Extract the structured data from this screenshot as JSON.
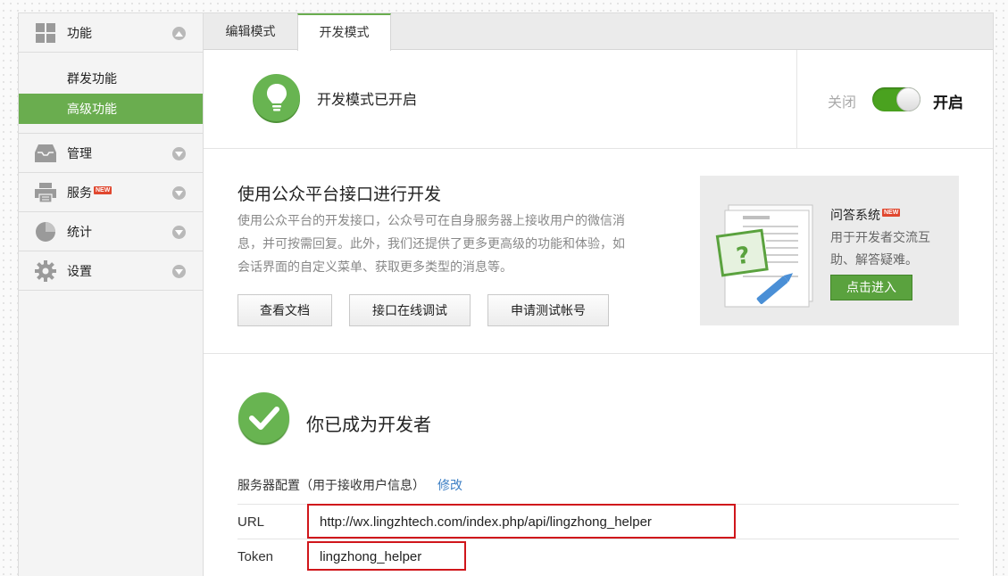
{
  "sidebar": {
    "groups": [
      {
        "label": "功能",
        "icon": "grid-icon"
      },
      {
        "label": "管理",
        "icon": "inbox-icon"
      },
      {
        "label": "服务",
        "icon": "printer-icon",
        "badge": "NEW"
      },
      {
        "label": "统计",
        "icon": "pie-chart-icon"
      },
      {
        "label": "设置",
        "icon": "gear-icon"
      }
    ],
    "sub_items": [
      {
        "label": "群发功能"
      },
      {
        "label": "高级功能"
      }
    ]
  },
  "tabs": [
    {
      "label": "编辑模式"
    },
    {
      "label": "开发模式"
    }
  ],
  "status": {
    "text": "开发模式已开启",
    "toggle_off_label": "关闭",
    "toggle_on_label": "开启",
    "toggle_state": "on"
  },
  "api": {
    "title": "使用公众平台接口进行开发",
    "desc_lines": [
      "使用公众平台的开发接口，公众号可在自身服务器上接收用户的微信消",
      "息，并可按需回复。此外，我们还提供了更多更高级的功能和体验，如",
      "会话界面的自定义菜单、获取更多类型的消息等。"
    ],
    "buttons": [
      "查看文档",
      "接口在线调试",
      "申请测试帐号"
    ]
  },
  "qa": {
    "title": "问答系统",
    "badge": "NEW",
    "desc_lines": [
      "用于开发者交流互",
      "助、解答疑难。"
    ],
    "button": "点击进入"
  },
  "developer": {
    "title": "你已成为开发者",
    "config_label": "服务器配置（用于接收用户信息）",
    "edit_link": "修改",
    "rows": [
      {
        "key": "URL",
        "value": "http://wx.lingzhtech.com/index.php/api/lingzhong_helper"
      },
      {
        "key": "Token",
        "value": "lingzhong_helper"
      }
    ]
  },
  "colors": {
    "accent_green": "#6aad4f",
    "highlight_red": "#d0161b",
    "link_blue": "#3d7fc4",
    "new_badge": "#e0472f"
  }
}
